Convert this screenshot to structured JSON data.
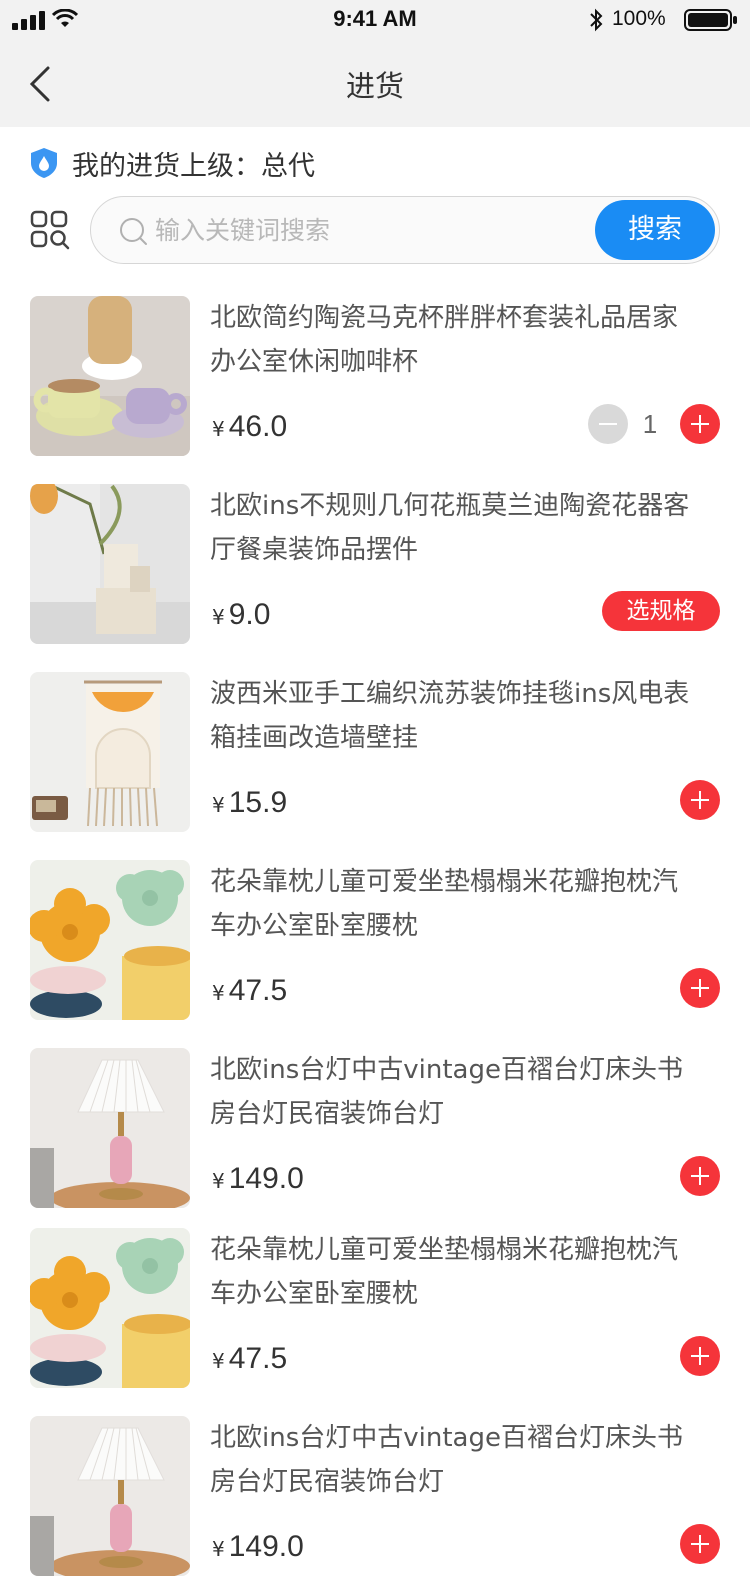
{
  "status_bar": {
    "time": "9:41 AM",
    "battery": "100%"
  },
  "nav": {
    "title": "进货",
    "back_icon": "chevron-left-icon"
  },
  "superior": {
    "label": "我的进货上级：",
    "value": "总代",
    "icon": "shield-icon"
  },
  "search": {
    "placeholder": "输入关键词搜索",
    "button_label": "搜索",
    "category_icon": "grid-search-icon"
  },
  "colors": {
    "accent_blue": "#1a8cf4",
    "accent_red": "#f5343a",
    "header_bg": "#f2f2f2"
  },
  "products": [
    {
      "name": "北欧简约陶瓷马克杯胖胖杯套装礼品居家办公室休闲咖啡杯",
      "currency": "¥",
      "price": "46.0",
      "action": "stepper",
      "quantity": "1"
    },
    {
      "name": "北欧ins不规则几何花瓶莫兰迪陶瓷花器客厅餐桌装饰品摆件",
      "currency": "¥",
      "price": "9.0",
      "action": "spec",
      "spec_label": "选规格"
    },
    {
      "name": "波西米亚手工编织流苏装饰挂毯ins风电表箱挂画改造墙壁挂",
      "currency": "¥",
      "price": "15.9",
      "action": "add"
    },
    {
      "name": "花朵靠枕儿童可爱坐垫榻榻米花瓣抱枕汽车办公室卧室腰枕",
      "currency": "¥",
      "price": "47.5",
      "action": "add"
    },
    {
      "name": "北欧ins台灯中古vintage百褶台灯床头书房台灯民宿装饰台灯",
      "currency": "¥",
      "price": "149.0",
      "action": "add"
    },
    {
      "name": "花朵靠枕儿童可爱坐垫榻榻米花瓣抱枕汽车办公室卧室腰枕",
      "currency": "¥",
      "price": "47.5",
      "action": "add"
    },
    {
      "name": "北欧ins台灯中古vintage百褶台灯床头书房台灯民宿装饰台灯",
      "currency": "¥",
      "price": "149.0",
      "action": "add"
    }
  ]
}
